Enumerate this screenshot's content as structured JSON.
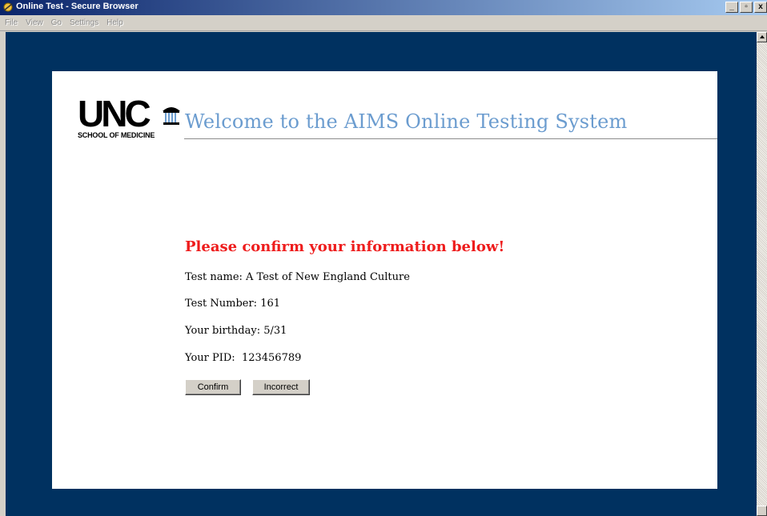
{
  "window": {
    "title": "Online Test - Secure Browser",
    "minimize": "_",
    "maximize": "▫",
    "close": "x"
  },
  "menu": [
    "File",
    "View",
    "Go",
    "Settings",
    "Help"
  ],
  "logo": {
    "letters": "UNC",
    "subtitle": "SCHOOL OF MEDICINE"
  },
  "page": {
    "welcome": "Welcome to the AIMS Online Testing System",
    "heading": "Please confirm your information below!",
    "test_name_line": "Test name: A Test of New England Culture",
    "test_number_line": "Test Number: 161",
    "birthday_line": "Your birthday: 5/31",
    "pid_line": "Your PID:  123456789"
  },
  "buttons": {
    "confirm": "Confirm",
    "incorrect": "Incorrect"
  },
  "colors": {
    "background": "#003160",
    "welcome_text": "#6b9ccf",
    "heading_text": "#ee1c1c"
  }
}
